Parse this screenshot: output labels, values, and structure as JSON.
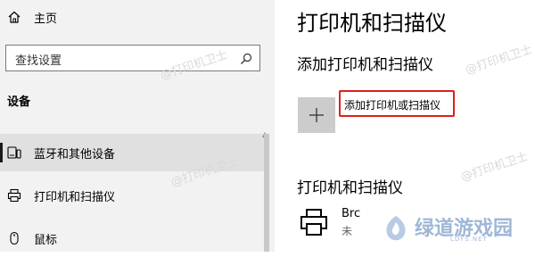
{
  "sidebar": {
    "home_label": "主页",
    "search_placeholder": "查找设置",
    "section_title": "设备",
    "items": [
      {
        "label": "蓝牙和其他设备",
        "icon": "bluetooth-devices-icon",
        "active": true
      },
      {
        "label": "打印机和扫描仪",
        "icon": "printer-icon",
        "active": false
      },
      {
        "label": "鼠标",
        "icon": "mouse-icon",
        "active": false
      }
    ]
  },
  "main": {
    "title": "打印机和扫描仪",
    "add_section_title": "添加打印机和扫描仪",
    "add_button_label": "添加打印机或扫描仪",
    "printers_section_title": "打印机和扫描仪",
    "printers": [
      {
        "name": "Brc",
        "status": "未"
      }
    ]
  },
  "watermarks": {
    "text": "@打印机卫士",
    "logo_text": "绿道游戏园",
    "logo_sub": "LDYS.NET"
  },
  "colors": {
    "sidebar_bg": "#f2f2f2",
    "active_item_bg": "#e0e0e0",
    "highlight_border": "#e0201b",
    "add_button_bg": "#cccccc"
  }
}
